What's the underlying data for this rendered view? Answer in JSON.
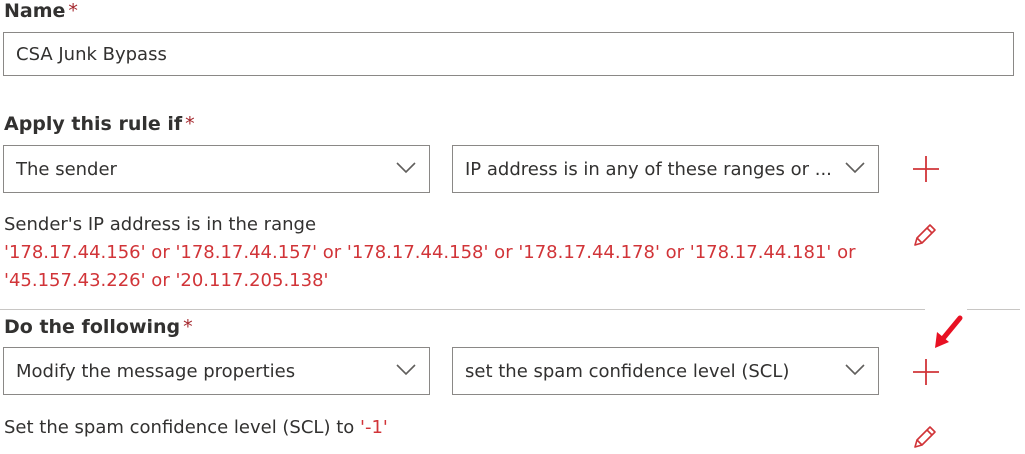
{
  "name_field": {
    "label": "Name",
    "required_mark": "*",
    "value": "CSA Junk Bypass"
  },
  "apply_rule": {
    "label": "Apply this rule if",
    "required_mark": "*",
    "condition_dropdown": "The sender",
    "criteria_dropdown": "IP address is in any of these ranges or ...",
    "description_prefix": "Sender's IP address is in the range",
    "description_value": "'178.17.44.156' or '178.17.44.157' or '178.17.44.158' or '178.17.44.178' or '178.17.44.181' or '45.157.43.226' or '20.117.205.138'"
  },
  "do_following": {
    "label": "Do the following",
    "required_mark": "*",
    "action_dropdown": "Modify the message properties",
    "property_dropdown": "set the spam confidence level (SCL)",
    "description_prefix": "Set the spam confidence level (SCL) to",
    "description_value": "'-1'"
  },
  "icons": {
    "add": "plus-icon",
    "edit": "pencil-icon",
    "dropdown": "chevron-down-icon",
    "annotation": "red-arrow-icon"
  },
  "colors": {
    "accent_red": "#d13438",
    "required_red": "#a4262c",
    "text": "#323130",
    "border": "#8a8886"
  }
}
